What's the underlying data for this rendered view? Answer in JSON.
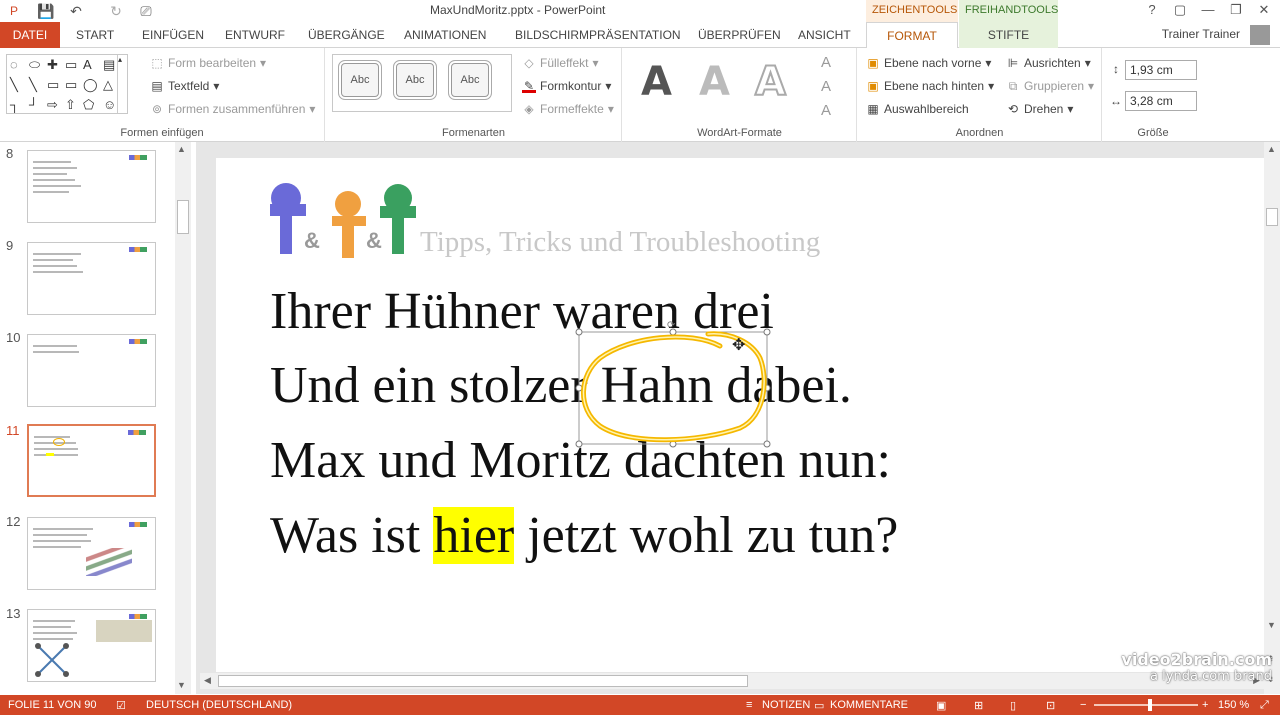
{
  "window": {
    "title": "MaxUndMoritz.pptx - PowerPoint",
    "context_tabs": [
      "ZEICHENTOOLS",
      "FREIHANDTOOLS"
    ],
    "controls": [
      "?",
      "▢",
      "—",
      "❐",
      "✕"
    ]
  },
  "tabs": [
    "DATEI",
    "START",
    "EINFÜGEN",
    "ENTWURF",
    "ÜBERGÄNGE",
    "ANIMATIONEN",
    "BILDSCHIRMPRÄSENTATION",
    "ÜBERPRÜFEN",
    "ANSICHT",
    "FORMAT",
    "STIFTE"
  ],
  "user": "Trainer Trainer",
  "ribbon": {
    "formen_einfuegen": {
      "label": "Formen einfügen",
      "form_bearbeiten": "Form bearbeiten",
      "textfeld": "Textfeld",
      "formen_zusammenfuehren": "Formen zusammenführen"
    },
    "formenarten": {
      "label": "Formenarten",
      "styles": [
        "Abc",
        "Abc",
        "Abc"
      ],
      "fuelleffekt": "Fülleffekt",
      "formkontur": "Formkontur",
      "formeffekte": "Formeffekte"
    },
    "wordart": {
      "label": "WordArt-Formate",
      "letters": [
        "A",
        "A",
        "A"
      ]
    },
    "anordnen": {
      "label": "Anordnen",
      "ebene_vorne": "Ebene nach vorne",
      "ebene_hinten": "Ebene nach hinten",
      "auswahlbereich": "Auswahlbereich",
      "ausrichten": "Ausrichten",
      "gruppieren": "Gruppieren",
      "drehen": "Drehen"
    },
    "groesse": {
      "label": "Größe",
      "height": "1,93 cm",
      "width": "3,28 cm"
    }
  },
  "thumbnails": [
    {
      "number": "8"
    },
    {
      "number": "9"
    },
    {
      "number": "10"
    },
    {
      "number": "11"
    },
    {
      "number": "12"
    },
    {
      "number": "13"
    }
  ],
  "slide": {
    "logo_text": "Tipps, Tricks und Troubleshooting",
    "lines": {
      "line1": "Ihrer Hühner waren drei",
      "line2": "Und ein stolzer Hahn dabei.",
      "line3": "Max und Moritz dachten nun:",
      "line4_pre": "Was ist ",
      "line4_hl": "hier",
      "line4_post": " jetzt wohl zu tun?"
    }
  },
  "watermark": {
    "line1": "video2brain.com",
    "line2": "a lynda.com brand"
  },
  "status": {
    "slide_info": "FOLIE 11 VON 90",
    "language": "DEUTSCH (DEUTSCHLAND)",
    "notes": "NOTIZEN",
    "comments": "KOMMENTARE",
    "zoom": "150 %"
  },
  "colors": {
    "accent": "#d24726",
    "format_tab": "#b65708",
    "ink": "#f5b800",
    "highlight": "#ffff00"
  }
}
